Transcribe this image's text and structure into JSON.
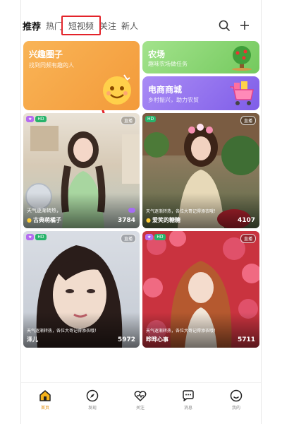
{
  "tabs": [
    {
      "label": "推荐",
      "active": true
    },
    {
      "label": "热门",
      "active": false
    },
    {
      "label": "短视频",
      "active": false,
      "highlighted": true
    },
    {
      "label": "关注",
      "active": false
    },
    {
      "label": "新人",
      "active": false
    }
  ],
  "icons": {
    "search": "search-icon",
    "add": "plus-icon"
  },
  "cards": {
    "interest": {
      "title": "兴趣圈子",
      "subtitle": "找到同频有趣的人",
      "color": "#f7a94a"
    },
    "farm": {
      "title": "农场",
      "subtitle": "趣味农场做任务",
      "color": "#8fd97a"
    },
    "mall": {
      "title": "电商商城",
      "subtitle": "乡村振兴，助力农贸",
      "color": "#9b7bf0"
    }
  },
  "videos": [
    {
      "caption": "天气逐渐转热，",
      "name": "古典萌橘子",
      "count": "3784",
      "badges": [
        "HD"
      ],
      "live": "直播"
    },
    {
      "caption": "天气逐渐转热，各位大哥记得添衣哦！",
      "name": "爱笑的糖糖",
      "count": "4107",
      "badges": [
        "HD"
      ],
      "live": "直播"
    },
    {
      "caption": "天气逐渐转热，各位大哥记得添衣哦！",
      "name": "泽儿",
      "count": "5972",
      "badges": [
        "HD"
      ],
      "live": "直播"
    },
    {
      "caption": "天气逐渐转热，各位大哥记得添衣哦！",
      "name": "晔晔心事",
      "count": "5711",
      "badges": [
        "HD"
      ],
      "live": "直播"
    }
  ],
  "nav": [
    {
      "label": "首页",
      "icon": "home-icon",
      "active": true
    },
    {
      "label": "发现",
      "icon": "compass-icon",
      "active": false
    },
    {
      "label": "关注",
      "icon": "heart-pulse-icon",
      "active": false
    },
    {
      "label": "消息",
      "icon": "chat-icon",
      "active": false
    },
    {
      "label": "我的",
      "icon": "smile-icon",
      "active": false
    }
  ],
  "colors": {
    "accent": "#e3232a",
    "nav_active": "#e38a00"
  }
}
